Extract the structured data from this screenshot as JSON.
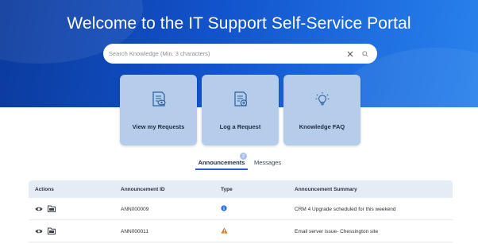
{
  "hero": {
    "title": "Welcome to the IT Support Self-Service Portal",
    "background_color": "#1253cc"
  },
  "search": {
    "placeholder": "Search Knowledge (Min. 3 characters)",
    "value": "",
    "clear_icon": "close-icon",
    "submit_icon": "search-icon"
  },
  "cards": [
    {
      "label": "View my Requests",
      "icon": "document-view-icon"
    },
    {
      "label": "Log a Request",
      "icon": "document-add-icon"
    },
    {
      "label": "Knowledge FAQ",
      "icon": "lightbulb-icon"
    }
  ],
  "tabs": [
    {
      "label": "Announcements",
      "active": true,
      "badge": "2"
    },
    {
      "label": "Messages",
      "active": false
    }
  ],
  "table": {
    "headers": [
      "Actions",
      "Announcement ID",
      "Type",
      "Announcement Summary"
    ],
    "rows": [
      {
        "id": "ANN000009",
        "type": "info",
        "type_icon": "info-icon",
        "type_color": "#2f6fd6",
        "summary": "CRM 4 Upgrade scheduled for this weekend"
      },
      {
        "id": "ANN000011",
        "type": "warning",
        "type_icon": "warning-icon",
        "type_color": "#e8791e",
        "summary": "Email server issue- Chessington site"
      }
    ]
  }
}
